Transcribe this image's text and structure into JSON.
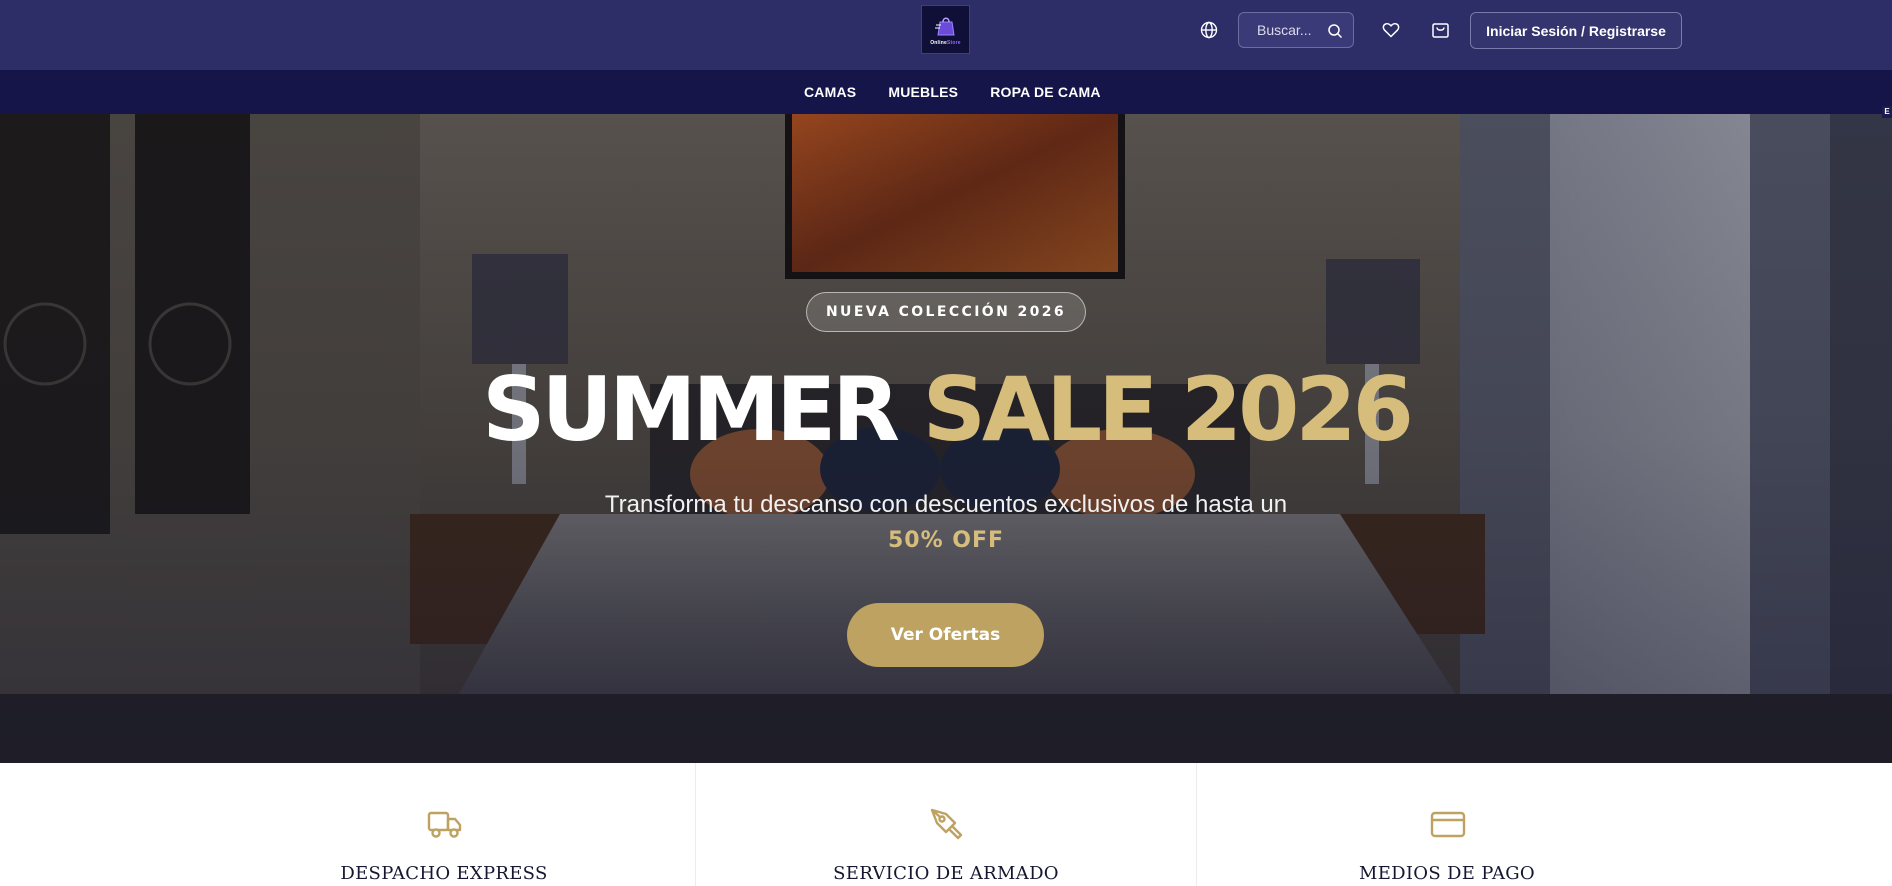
{
  "header": {
    "logo": {
      "brand_text_a": "Online",
      "brand_text_b": "Store",
      "icon": "shopping-bag-logo"
    },
    "language_icon": "globe-icon",
    "search": {
      "placeholder": "Buscar...",
      "icon": "search-icon"
    },
    "favorites_icon": "heart-icon",
    "cart_icon": "shopping-bag-icon",
    "login_label": "Iniciar Sesión / Registrarse"
  },
  "nav": {
    "items": [
      {
        "label": "CAMAS"
      },
      {
        "label": "MUEBLES"
      },
      {
        "label": "ROPA DE CAMA"
      }
    ]
  },
  "hero": {
    "badge": "NUEVA COLECCIÓN 2026",
    "headline_white": "SUMMER",
    "headline_gold": "SALE 2026",
    "subtext": "Transforma tu descanso con descuentos exclusivos de hasta un",
    "offer": "50% OFF",
    "cta_label": "Ver Ofertas",
    "edge_tag": "E"
  },
  "features": [
    {
      "title": "DESPACHO EXPRESS",
      "icon": "truck-icon"
    },
    {
      "title": "SERVICIO DE ARMADO",
      "icon": "pen-tool-icon"
    },
    {
      "title": "MEDIOS DE PAGO",
      "icon": "credit-card-icon"
    }
  ],
  "colors": {
    "header_bg": "#2d2d68",
    "nav_bg": "#15154a",
    "accent_gold": "#bda261",
    "headline_gold": "#d6bd7c"
  }
}
